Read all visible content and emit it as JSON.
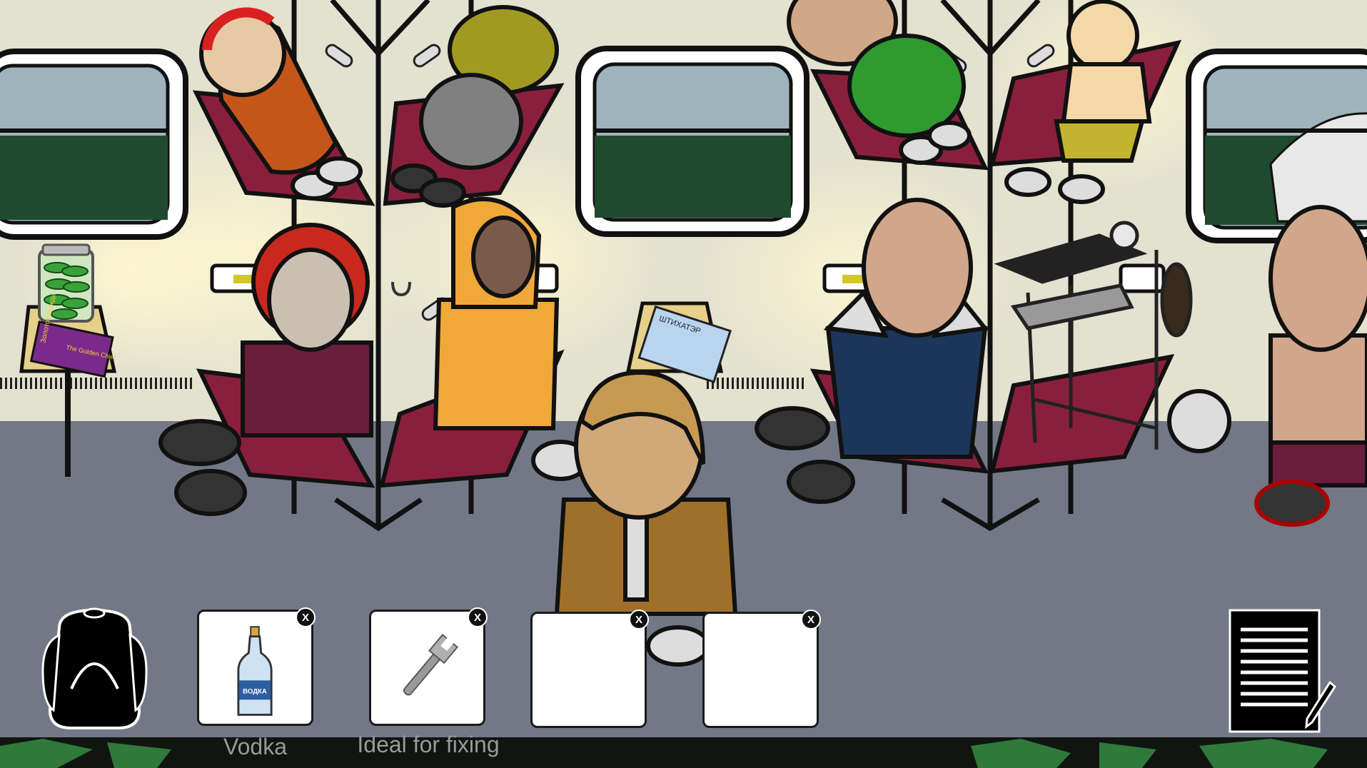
{
  "inventory": {
    "slots": [
      {
        "item": "vodka",
        "icon": "vodka-bottle-icon",
        "bottle_text": "ВОДКА",
        "label": "Vodka",
        "close": "X"
      },
      {
        "item": "wrench",
        "icon": "wrench-icon",
        "label": "Ideal for fixing",
        "close": "X"
      },
      {
        "item": "",
        "close": "X"
      },
      {
        "item": "",
        "close": "X"
      }
    ]
  },
  "scene": {
    "book_title_ru": "Золотой Вождь",
    "book_title_en": "The Golden Chief",
    "poster_title": "ШТИХАТЭР"
  },
  "colors": {
    "wall": "#e3e1cf",
    "floor": "#737887",
    "bunk": "#8a1f3d",
    "window_glass": "#1f4a2e",
    "strip_green": "#2f7a3a"
  },
  "icons": {
    "backpack": "backpack-icon",
    "notes": "notepad-pencil-icon"
  }
}
